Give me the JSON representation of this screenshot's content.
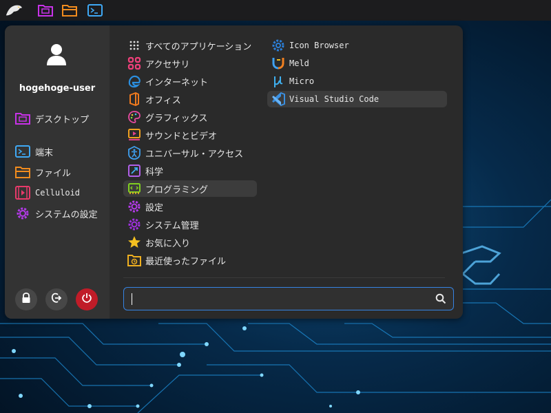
{
  "panel": {
    "items": [
      {
        "icon": "eagle-logo-icon"
      },
      {
        "icon": "desktop-folder-icon"
      },
      {
        "icon": "folder-icon"
      },
      {
        "icon": "terminal-icon"
      }
    ]
  },
  "user": {
    "name": "hogehoge-user"
  },
  "sidebar": {
    "places": [
      {
        "label": "デスクトップ",
        "icon": "desktop-folder-icon"
      },
      {
        "label": "端末",
        "icon": "terminal-icon"
      },
      {
        "label": "ファイル",
        "icon": "folder-icon"
      },
      {
        "label": "Celluloid",
        "icon": "video-player-icon"
      },
      {
        "label": "システムの設定",
        "icon": "settings-gear-icon"
      }
    ],
    "actions": [
      {
        "name": "lock",
        "icon": "lock-icon"
      },
      {
        "name": "logout",
        "icon": "logout-icon"
      },
      {
        "name": "power",
        "icon": "power-icon"
      }
    ]
  },
  "categories": [
    {
      "label": "すべてのアプリケーション",
      "icon": "grid-icon"
    },
    {
      "label": "アクセサリ",
      "icon": "accessories-icon"
    },
    {
      "label": "インターネット",
      "icon": "internet-icon"
    },
    {
      "label": "オフィス",
      "icon": "office-icon"
    },
    {
      "label": "グラフィックス",
      "icon": "palette-icon"
    },
    {
      "label": "サウンドとビデオ",
      "icon": "multimedia-icon"
    },
    {
      "label": "ユニバーサル・アクセス",
      "icon": "accessibility-icon"
    },
    {
      "label": "科学",
      "icon": "science-icon"
    },
    {
      "label": "プログラミング",
      "icon": "programming-icon",
      "selected": true
    },
    {
      "label": "設定",
      "icon": "settings-gear-icon"
    },
    {
      "label": "システム管理",
      "icon": "system-gear-icon"
    },
    {
      "label": "お気に入り",
      "icon": "star-icon"
    },
    {
      "label": "最近使ったファイル",
      "icon": "recent-folder-icon"
    }
  ],
  "apps": [
    {
      "label": "Icon Browser",
      "icon": "icon-browser-icon"
    },
    {
      "label": "Meld",
      "icon": "meld-icon"
    },
    {
      "label": "Micro",
      "icon": "micro-icon"
    },
    {
      "label": "Visual Studio Code",
      "icon": "vscode-icon",
      "selected": true
    }
  ],
  "search": {
    "value": "",
    "placeholder": ""
  },
  "colors": {
    "accent": "#3584e4",
    "power": "#c01c28",
    "menu_bg": "#2a2a2a",
    "sidebar_bg": "#333333"
  }
}
